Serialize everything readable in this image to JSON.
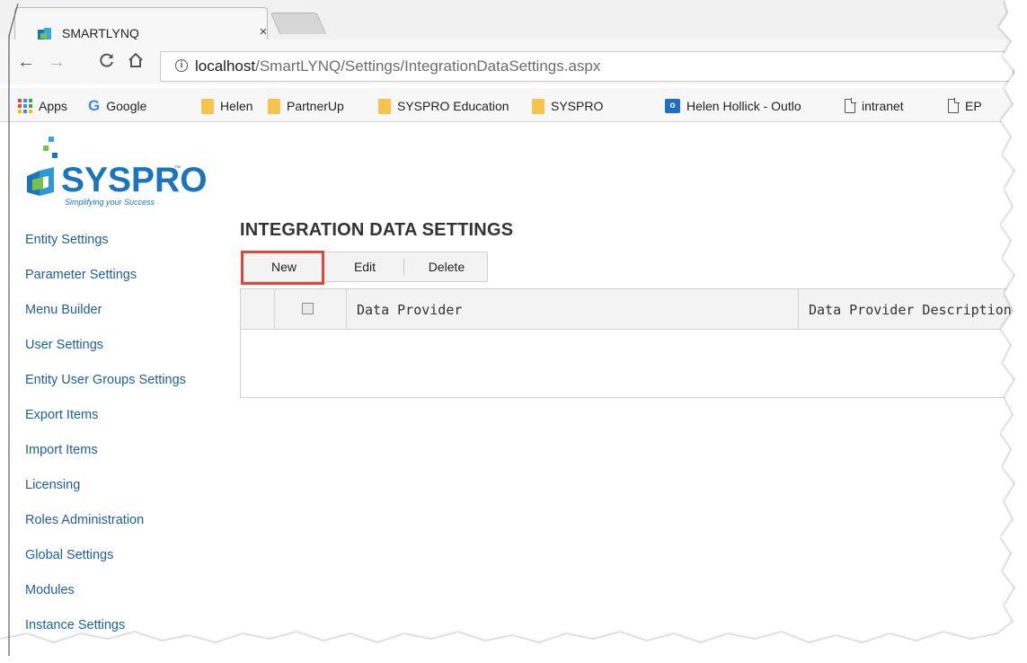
{
  "browser": {
    "tab": {
      "title": "SMARTLYNQ",
      "close": "×"
    },
    "nav": {
      "back": "←",
      "forward": "→",
      "reload": "C",
      "home": "⌂"
    },
    "address": {
      "info_icon": "i",
      "host": "localhost",
      "path": "/SmartLYNQ/Settings/IntegrationDataSettings.aspx"
    },
    "bookmarks": [
      {
        "label": "Apps",
        "icon": "apps-grid-icon"
      },
      {
        "label": "Google",
        "icon": "google-icon"
      },
      {
        "label": "Helen",
        "icon": "folder-icon"
      },
      {
        "label": "PartnerUp",
        "icon": "folder-icon"
      },
      {
        "label": "SYSPRO Education",
        "icon": "folder-icon"
      },
      {
        "label": "SYSPRO",
        "icon": "folder-icon"
      },
      {
        "label": "Helen Hollick - Outlo",
        "icon": "outlook-icon"
      },
      {
        "label": "intranet",
        "icon": "page-icon"
      },
      {
        "label": "EP",
        "icon": "page-icon"
      }
    ]
  },
  "logo": {
    "text": "SYSPRO",
    "tm": "™",
    "tagline": "Simplifying your Success"
  },
  "sidebar": {
    "items": [
      {
        "label": "Entity Settings"
      },
      {
        "label": "Parameter Settings"
      },
      {
        "label": "Menu Builder"
      },
      {
        "label": "User Settings"
      },
      {
        "label": "Entity User Groups Settings"
      },
      {
        "label": "Export Items"
      },
      {
        "label": "Import Items"
      },
      {
        "label": "Licensing"
      },
      {
        "label": "Roles Administration"
      },
      {
        "label": "Global Settings"
      },
      {
        "label": "Modules"
      },
      {
        "label": "Instance Settings"
      }
    ]
  },
  "main": {
    "title": "INTEGRATION DATA SETTINGS",
    "actions": {
      "new_label": "New",
      "edit_label": "Edit",
      "delete_label": "Delete"
    },
    "grid": {
      "columns": [
        "",
        "",
        "Data Provider",
        "Data Provider Description"
      ],
      "rows": []
    }
  },
  "colors": {
    "link": "#1f5e9e",
    "brand": "#1b75bb",
    "highlight": "#e0473a"
  }
}
